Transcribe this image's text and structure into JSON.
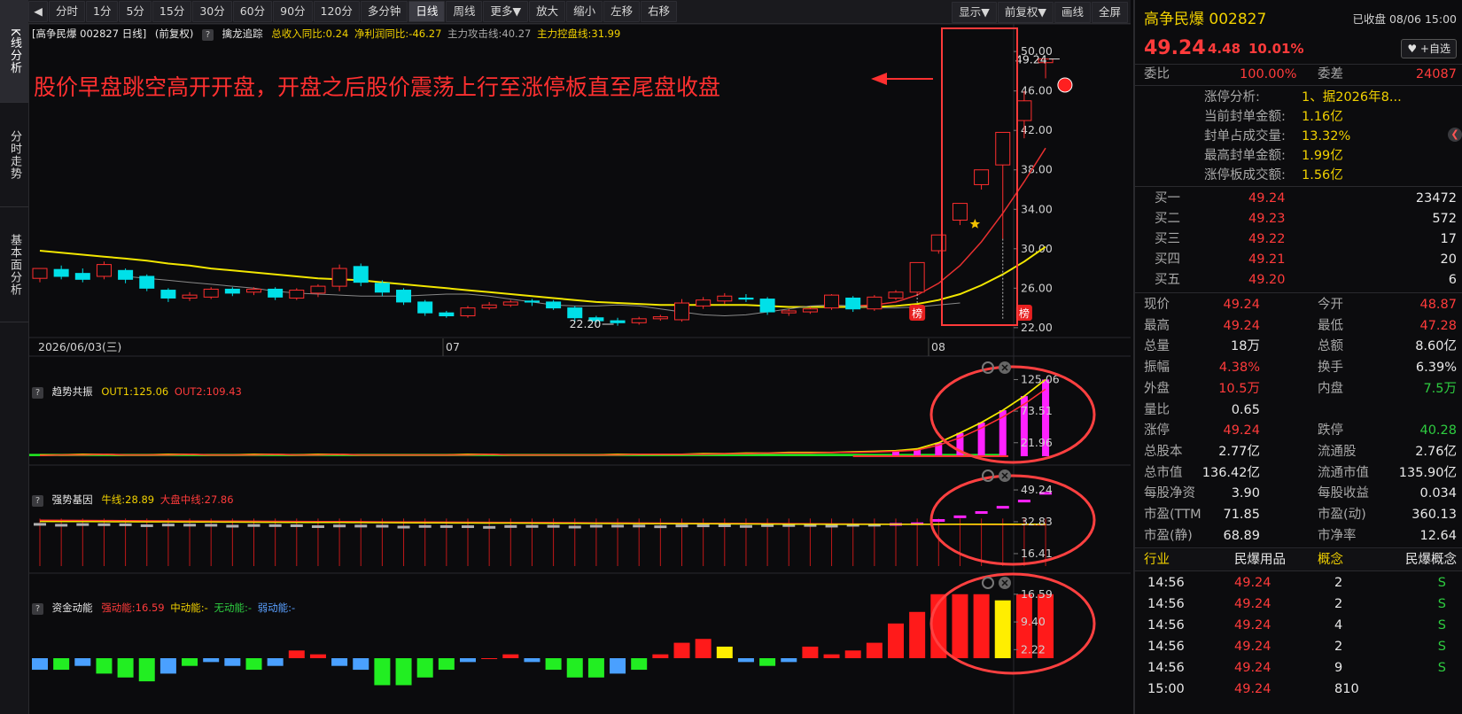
{
  "sidebar": {
    "tabs": [
      "K线分析",
      "分时走势",
      "基本面分析"
    ]
  },
  "toolbar": {
    "periods": [
      "分时",
      "1分",
      "5分",
      "15分",
      "30分",
      "60分",
      "90分",
      "120分",
      "多分钟",
      "日线",
      "周线",
      "更多▼",
      "放大",
      "缩小",
      "左移",
      "右移"
    ],
    "active": "日线",
    "right": [
      "显示▼",
      "前复权▼",
      "画线",
      "全屏"
    ]
  },
  "main_header": {
    "stock": "[高争民爆 002827 日线]",
    "adj": "(前复权)",
    "indicator": "擒龙追踪",
    "rev": "总收入同比:0.24",
    "profit": "净利润同比:-46.27",
    "atk": "主力攻击线:40.27",
    "ctrl": "主力控盘线:31.99"
  },
  "annotation": {
    "text": "股价早盘跳空高开开盘，开盘之后股价震荡上行至涨停板直至尾盘收盘"
  },
  "price_axis": {
    "labels": [
      "50.00",
      "46.00",
      "42.00",
      "38.00",
      "34.00",
      "30.00",
      "26.00",
      "22.00"
    ]
  },
  "price_marks": {
    "high": "49.24",
    "low": "22.20"
  },
  "badge": {
    "text": "榜"
  },
  "date_axis": {
    "d1": "2026/06/03(三)",
    "d2": "07",
    "d3": "08"
  },
  "panel1": {
    "name": "趋势共振",
    "out1": "OUT1:125.06",
    "out2": "OUT2:109.43",
    "axis": [
      "125.06",
      "73.51",
      "21.96"
    ]
  },
  "panel2": {
    "name": "强势基因",
    "bull": "牛线:28.89",
    "market": "大盘中线:27.86",
    "axis": [
      "49.24",
      "32.83",
      "16.41"
    ]
  },
  "panel3": {
    "name": "资金动能",
    "strong": "强动能:16.59",
    "mid": "中动能:-",
    "none": "无动能:-",
    "weak": "弱动能:-",
    "axis": [
      "16.59",
      "9.40",
      "2.22"
    ]
  },
  "chart_data": {
    "type": "candlestick",
    "title": "高争民爆 002827 日线",
    "ylim": [
      21,
      51
    ],
    "yticks": [
      22,
      26,
      30,
      34,
      38,
      42,
      46,
      50
    ],
    "candles": [
      [
        27.0,
        28.0,
        26.6,
        27.5
      ],
      [
        27.9,
        27.2,
        26.9,
        28.3
      ],
      [
        27.5,
        26.9,
        26.6,
        28.0
      ],
      [
        27.2,
        28.4,
        26.9,
        28.7
      ],
      [
        27.8,
        26.9,
        26.5,
        28.0
      ],
      [
        27.2,
        26.0,
        25.7,
        27.4
      ],
      [
        25.8,
        25.0,
        24.6,
        26.0
      ],
      [
        25.0,
        25.3,
        24.7,
        25.6
      ],
      [
        25.1,
        25.9,
        24.9,
        26.1
      ],
      [
        25.9,
        25.5,
        25.2,
        26.1
      ],
      [
        25.6,
        25.9,
        25.3,
        26.1
      ],
      [
        25.9,
        25.1,
        24.8,
        26.1
      ],
      [
        25.0,
        25.8,
        24.8,
        26.0
      ],
      [
        25.5,
        26.2,
        25.1,
        26.4
      ],
      [
        26.2,
        28.0,
        25.7,
        28.4
      ],
      [
        28.2,
        26.6,
        26.2,
        28.5
      ],
      [
        26.5,
        25.6,
        25.2,
        26.8
      ],
      [
        25.8,
        24.6,
        24.3,
        26.0
      ],
      [
        24.6,
        23.5,
        23.2,
        24.8
      ],
      [
        23.5,
        23.2,
        23.0,
        23.7
      ],
      [
        23.2,
        24.0,
        23.0,
        24.2
      ],
      [
        24.0,
        24.3,
        23.8,
        24.6
      ],
      [
        24.3,
        24.6,
        24.1,
        24.8
      ],
      [
        24.7,
        24.6,
        24.2,
        24.9
      ],
      [
        24.6,
        24.0,
        23.8,
        24.8
      ],
      [
        24.0,
        23.0,
        22.6,
        24.2
      ],
      [
        23.0,
        22.7,
        22.5,
        23.2
      ],
      [
        22.7,
        22.5,
        22.2,
        23.0
      ],
      [
        22.5,
        22.9,
        22.3,
        23.1
      ],
      [
        22.9,
        23.1,
        22.7,
        23.3
      ],
      [
        22.8,
        24.5,
        22.6,
        24.9
      ],
      [
        24.2,
        24.8,
        23.9,
        25.1
      ],
      [
        24.7,
        25.2,
        24.4,
        25.5
      ],
      [
        25.0,
        24.9,
        24.6,
        25.4
      ],
      [
        24.9,
        23.6,
        23.3,
        25.1
      ],
      [
        23.5,
        23.7,
        23.2,
        23.9
      ],
      [
        23.6,
        23.9,
        23.4,
        24.1
      ],
      [
        24.0,
        25.3,
        23.8,
        25.4
      ],
      [
        25.0,
        23.9,
        23.6,
        25.2
      ],
      [
        23.9,
        25.1,
        23.7,
        25.3
      ],
      [
        25.0,
        25.6,
        24.8,
        25.8
      ],
      [
        25.6,
        28.6,
        25.4,
        28.6
      ],
      [
        29.8,
        31.4,
        29.5,
        31.4
      ],
      [
        32.9,
        34.6,
        32.4,
        34.6
      ],
      [
        36.5,
        38.0,
        36.0,
        38.0
      ],
      [
        38.5,
        41.8,
        31.0,
        41.8
      ],
      [
        43.0,
        45.0,
        41.2,
        46.0
      ],
      [
        48.87,
        49.24,
        47.28,
        49.24
      ]
    ],
    "ma_yellow": [
      29.8,
      29.6,
      29.4,
      29.2,
      29.0,
      28.8,
      28.5,
      28.3,
      28.0,
      27.8,
      27.6,
      27.4,
      27.2,
      27.0,
      26.9,
      26.8,
      26.6,
      26.4,
      26.2,
      26.0,
      25.8,
      25.6,
      25.4,
      25.2,
      25.0,
      24.8,
      24.6,
      24.5,
      24.4,
      24.3,
      24.3,
      24.3,
      24.3,
      24.3,
      24.2,
      24.1,
      24.1,
      24.1,
      24.1,
      24.1,
      24.2,
      24.4,
      24.8,
      25.4,
      26.3,
      27.4,
      28.7,
      30.2
    ],
    "panel1_out1": [
      2,
      2,
      3,
      3,
      2,
      2,
      3,
      3,
      2,
      2,
      3,
      3,
      2,
      3,
      3,
      2,
      2,
      2,
      2,
      2,
      3,
      3,
      2,
      2,
      2,
      2,
      2,
      3,
      3,
      3,
      3,
      4,
      4,
      5,
      5,
      6,
      6,
      6,
      7,
      8,
      9,
      12,
      22,
      38,
      55,
      75,
      98,
      125.06
    ],
    "panel1_out2": [
      1,
      2,
      2,
      3,
      2,
      2,
      2,
      3,
      2,
      2,
      2,
      3,
      2,
      2,
      3,
      2,
      2,
      2,
      2,
      2,
      2,
      3,
      2,
      2,
      2,
      2,
      2,
      2,
      3,
      3,
      3,
      3,
      4,
      4,
      5,
      5,
      5,
      6,
      6,
      7,
      8,
      10,
      18,
      30,
      46,
      64,
      85,
      109.43
    ],
    "panel1_bars_from": 40,
    "panel2_bull": [
      28.89
    ],
    "panel2_market": [
      27.86
    ],
    "panel3_bars": [
      -3,
      -3,
      -2,
      -4,
      -5,
      -6,
      -4,
      -2,
      -1,
      -2,
      -3,
      -2,
      2,
      1,
      -2,
      -3,
      -7,
      -7,
      -5,
      -3,
      -1,
      0,
      1,
      -1,
      -3,
      -5,
      -5,
      -4,
      -3,
      1,
      4,
      5,
      3,
      -1,
      -2,
      -1,
      3,
      1,
      2,
      4,
      9,
      12,
      16.59,
      16.59,
      16.59,
      15,
      16.59,
      16.59
    ]
  },
  "right": {
    "title": "高争民爆 002827",
    "status": "已收盘 08/06 15:00",
    "price": "49.24",
    "change": "4.48",
    "pct": "10.01%",
    "watch": "♥ +自选",
    "weibi_label": "委比",
    "weibi": "100.00%",
    "weicha_label": "委差",
    "weicha": "24087",
    "zt_lines": [
      [
        "涨停分析:",
        "1、据2026年8..."
      ],
      [
        "当前封单金额:",
        "1.16亿"
      ],
      [
        "封单占成交量:",
        "13.32%"
      ],
      [
        "最高封单金额:",
        "1.99亿"
      ],
      [
        "涨停板成交额:",
        "1.56亿"
      ]
    ],
    "buy": [
      [
        "买一",
        "49.24",
        "23472"
      ],
      [
        "买二",
        "49.23",
        "572"
      ],
      [
        "买三",
        "49.22",
        "17"
      ],
      [
        "买四",
        "49.21",
        "20"
      ],
      [
        "买五",
        "49.20",
        "6"
      ]
    ],
    "quote": [
      [
        "现价",
        "49.24",
        "今开",
        "48.87"
      ],
      [
        "最高",
        "49.24",
        "最低",
        "47.28"
      ],
      [
        "总量",
        "18万",
        "总额",
        "8.60亿"
      ],
      [
        "振幅",
        "4.38%",
        "换手",
        "6.39%"
      ],
      [
        "外盘",
        "10.5万",
        "内盘",
        "7.5万"
      ],
      [
        "量比",
        "0.65",
        "",
        ""
      ],
      [
        "涨停",
        "49.24",
        "跌停",
        "40.28"
      ],
      [
        "总股本",
        "2.77亿",
        "流通股",
        "2.76亿"
      ],
      [
        "总市值",
        "136.42亿",
        "流通市值",
        "135.90亿"
      ],
      [
        "每股净资",
        "3.90",
        "每股收益",
        "0.034"
      ],
      [
        "市盈(TTM",
        "71.85",
        "市盈(动)",
        "360.13"
      ],
      [
        "市盈(静)",
        "68.89",
        "市净率",
        "12.64"
      ]
    ],
    "industry": [
      "行业",
      "民爆用品",
      "概念",
      "民爆概念"
    ],
    "ticks": [
      [
        "14:56",
        "49.24",
        "2",
        "S"
      ],
      [
        "14:56",
        "49.24",
        "2",
        "S"
      ],
      [
        "14:56",
        "49.24",
        "4",
        "S"
      ],
      [
        "14:56",
        "49.24",
        "2",
        "S"
      ],
      [
        "14:56",
        "49.24",
        "9",
        "S"
      ],
      [
        "15:00",
        "49.24",
        "810",
        ""
      ]
    ]
  }
}
